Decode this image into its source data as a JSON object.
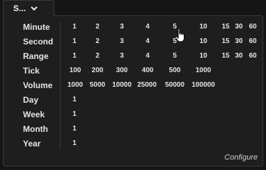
{
  "tab": {
    "label": "S..."
  },
  "rows": [
    {
      "label": "Minute",
      "values": [
        "1",
        "2",
        "3",
        "4",
        "5",
        "10",
        "15",
        "30",
        "60"
      ]
    },
    {
      "label": "Second",
      "values": [
        "1",
        "2",
        "3",
        "4",
        "5",
        "10",
        "15",
        "30",
        "60"
      ]
    },
    {
      "label": "Range",
      "values": [
        "1",
        "2",
        "3",
        "4",
        "5",
        "10",
        "15",
        "30",
        "60"
      ]
    },
    {
      "label": "Tick",
      "values": [
        "100",
        "200",
        "300",
        "400",
        "500",
        "1000"
      ]
    },
    {
      "label": "Volume",
      "values": [
        "1000",
        "5000",
        "10000",
        "25000",
        "50000",
        "100000"
      ]
    },
    {
      "label": "Day",
      "values": [
        "1"
      ]
    },
    {
      "label": "Week",
      "values": [
        "1"
      ]
    },
    {
      "label": "Month",
      "values": [
        "1"
      ]
    },
    {
      "label": "Year",
      "values": [
        "1"
      ]
    }
  ],
  "configure_label": "Configure",
  "colors": {
    "background": "#151515",
    "panel": "#1e1e1e",
    "text": "#e6e6e6"
  }
}
